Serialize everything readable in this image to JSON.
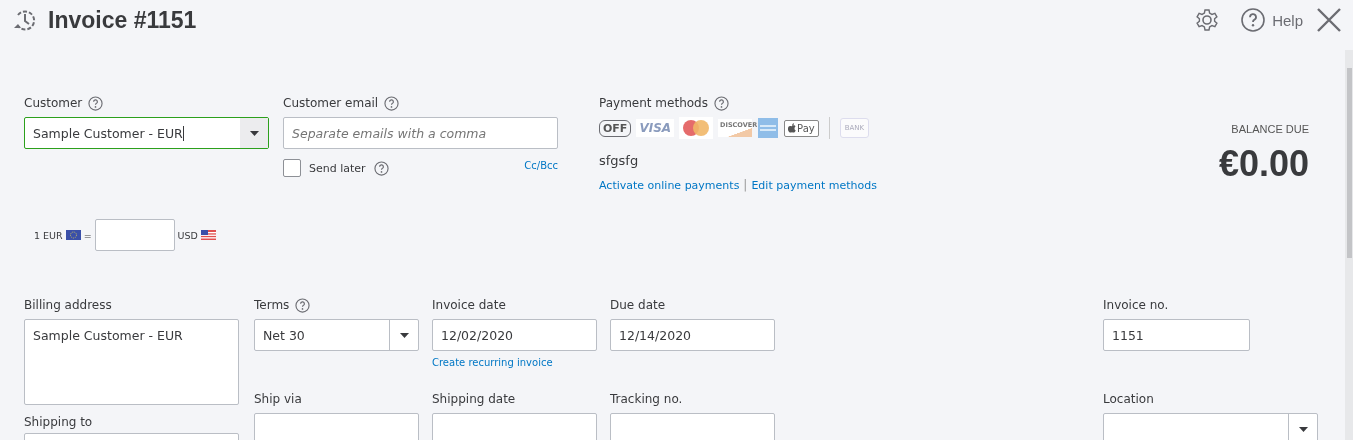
{
  "header": {
    "title": "Invoice #1151",
    "help": "Help"
  },
  "customer": {
    "label": "Customer",
    "value": "Sample Customer - EUR",
    "focused": true
  },
  "customer_email": {
    "label": "Customer email",
    "placeholder": "Separate emails with a comma",
    "send_later": {
      "label": "Send later",
      "checked": false
    },
    "cc_bcc": "Cc/Bcc"
  },
  "exchange_rate": {
    "from": "1 EUR",
    "equals": "=",
    "to": "USD"
  },
  "payment_methods": {
    "label": "Payment methods",
    "toggle": "OFF",
    "badges": [
      {
        "kind": "visa",
        "label": "VISA"
      },
      {
        "kind": "mastercard"
      },
      {
        "kind": "discover",
        "label": "DISCOVER"
      },
      {
        "kind": "amex"
      },
      {
        "kind": "applepay",
        "label": "Pay"
      }
    ],
    "bank": "BANK",
    "memo": "sfgsfg",
    "links": [
      "Activate online payments",
      "Edit payment methods"
    ],
    "separator": "|"
  },
  "balance": {
    "label": "BALANCE DUE",
    "amount": "€0.00"
  },
  "billing_address": {
    "label": "Billing address",
    "value": "Sample Customer - EUR"
  },
  "shipping_to": {
    "label": "Shipping to"
  },
  "terms": {
    "label": "Terms",
    "value": "Net 30"
  },
  "invoice_date": {
    "label": "Invoice date",
    "value": "12/02/2020",
    "link": "Create recurring invoice"
  },
  "due_date": {
    "label": "Due date",
    "value": "12/14/2020"
  },
  "ship_via": {
    "label": "Ship via"
  },
  "shipping_date": {
    "label": "Shipping date"
  },
  "tracking_no": {
    "label": "Tracking no."
  },
  "invoice_no": {
    "label": "Invoice no.",
    "value": "1151"
  },
  "location": {
    "label": "Location"
  }
}
